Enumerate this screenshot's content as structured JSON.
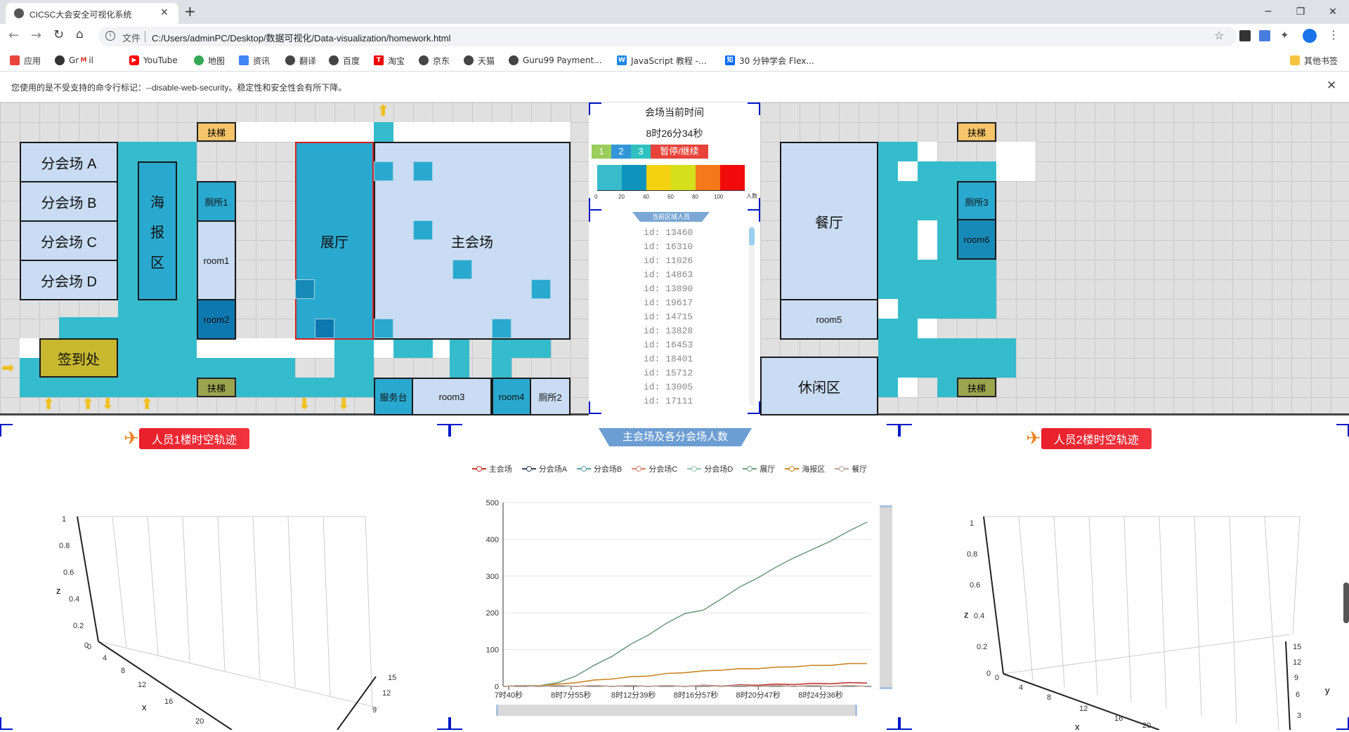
{
  "browser": {
    "tab_title": "CICSC大会安全可视化系统",
    "address_scheme_label": "文件",
    "address_url": "C:/Users/adminPC/Desktop/数据可视化/Data-visualization/homework.html",
    "bookmarks": [
      "应用",
      "Gmail",
      "YouTube",
      "地图",
      "资讯",
      "翻译",
      "百度",
      "淘宝",
      "京东",
      "天猫",
      "Guru99 Payment...",
      "JavaScript 教程 -...",
      "30 分钟学会 Flex..."
    ],
    "other_bookmarks": "其他书签",
    "infobar_text": "您使用的是不受支持的命令行标记：--disable-web-security。稳定性和安全性会有所下降。"
  },
  "floor1": {
    "rooms": {
      "a": "分会场 A",
      "b": "分会场 B",
      "c": "分会场 C",
      "d": "分会场 D",
      "poster1": "海",
      "poster2": "报",
      "poster3": "区",
      "toilet1": "厕所1",
      "room1": "room1",
      "room2": "room2",
      "exhibit": "展厅",
      "main": "主会场",
      "checkin": "签到处",
      "service": "服务台",
      "room3": "room3",
      "room4": "room4",
      "toilet2": "厕所2"
    },
    "escalator": "扶梯"
  },
  "floor2": {
    "rooms": {
      "dining": "餐厅",
      "toilet3": "厕所3",
      "room6": "room6",
      "room5": "room5",
      "lounge": "休闲区"
    },
    "escalator": "扶梯"
  },
  "control": {
    "title": "会场当前时间",
    "time": "8时26分34秒",
    "speed_buttons": [
      "1",
      "2",
      "3"
    ],
    "pause_button": "暂停/继续",
    "scale_ticks": [
      "0",
      "20",
      "40",
      "60",
      "80",
      "100"
    ],
    "scale_unit": "人数",
    "scale_colors": [
      "#38bccb",
      "#0e93bd",
      "#f5d20f",
      "#d4e01c",
      "#f5781a",
      "#f20b0b"
    ],
    "list_title": "当前区域人员",
    "ids": [
      "id: 13460",
      "id: 16310",
      "id: 11026",
      "id: 14863",
      "id: 13890",
      "id: 19617",
      "id: 14715",
      "id: 13828",
      "id: 16453",
      "id: 18401",
      "id: 15712",
      "id: 13005",
      "id: 17111"
    ]
  },
  "panels": {
    "left_title": "人员1楼时空轨迹",
    "center_title": "主会场及各分会场人数",
    "right_title": "人员2楼时空轨迹"
  },
  "axis3d_left": {
    "z_label": "z",
    "x_label": "x",
    "z_ticks": [
      "1",
      "0.8",
      "0.6",
      "0.4",
      "0.2",
      "0"
    ],
    "x_ticks": [
      "0",
      "4",
      "8",
      "12",
      "16",
      "20"
    ],
    "y_ticks": [
      "15",
      "12",
      "9"
    ]
  },
  "axis3d_right": {
    "z_label": "z",
    "x_label": "x",
    "y_label": "y",
    "z_ticks": [
      "1",
      "0.8",
      "0.6",
      "0.4",
      "0.2",
      "0"
    ],
    "x_ticks": [
      "0",
      "4",
      "8",
      "12",
      "16",
      "20"
    ],
    "y_ticks": [
      "15",
      "12",
      "9",
      "6",
      "3"
    ]
  },
  "chart_data": {
    "type": "line",
    "title": "主会场及各分会场人数",
    "series": [
      {
        "name": "主会场",
        "color": "#c23531",
        "values": [
          0,
          0,
          0,
          0,
          0,
          0,
          0,
          0,
          0,
          0,
          0,
          1,
          1,
          2,
          3,
          4,
          5,
          6,
          7,
          8,
          9
        ]
      },
      {
        "name": "分会场A",
        "color": "#2f4554",
        "values": [
          0,
          0,
          0,
          0,
          0,
          0,
          0,
          0,
          0,
          0,
          0,
          0,
          0,
          0,
          0,
          0,
          0,
          0,
          0,
          0,
          0
        ]
      },
      {
        "name": "分会场B",
        "color": "#61a0a8",
        "values": [
          0,
          0,
          0,
          0,
          0,
          0,
          0,
          0,
          0,
          0,
          0,
          0,
          0,
          0,
          0,
          0,
          0,
          0,
          0,
          0,
          0
        ]
      },
      {
        "name": "分会场C",
        "color": "#d48265",
        "values": [
          0,
          0,
          0,
          0,
          0,
          0,
          0,
          0,
          0,
          0,
          0,
          0,
          0,
          0,
          0,
          0,
          0,
          0,
          0,
          0,
          0
        ]
      },
      {
        "name": "分会场D",
        "color": "#91c7ae",
        "values": [
          0,
          0,
          0,
          0,
          0,
          0,
          0,
          0,
          0,
          0,
          0,
          0,
          0,
          0,
          0,
          0,
          0,
          0,
          0,
          0,
          0
        ]
      },
      {
        "name": "展厅",
        "color": "#749f83",
        "values": [
          0,
          0,
          2,
          8,
          28,
          55,
          82,
          112,
          140,
          170,
          198,
          205,
          238,
          268,
          295,
          322,
          350,
          370,
          395,
          420,
          447
        ]
      },
      {
        "name": "海报区",
        "color": "#ca8622",
        "values": [
          0,
          0,
          1,
          4,
          10,
          15,
          20,
          24,
          28,
          33,
          37,
          40,
          44,
          46,
          48,
          50,
          53,
          55,
          57,
          60,
          62
        ]
      },
      {
        "name": "餐厅",
        "color": "#bda29a",
        "values": [
          0,
          0,
          0,
          0,
          0,
          0,
          0,
          0,
          0,
          0,
          0,
          0,
          0,
          0,
          0,
          0,
          0,
          0,
          0,
          0,
          0
        ]
      }
    ],
    "x_labels": [
      "7时40秒",
      "8时7分55秒",
      "8时12分39秒",
      "8时16分57秒",
      "8时20分47秒",
      "8时24分36秒"
    ],
    "y_ticks": [
      "0",
      "100",
      "200",
      "300",
      "400",
      "500"
    ],
    "ylim": [
      0,
      500
    ]
  }
}
